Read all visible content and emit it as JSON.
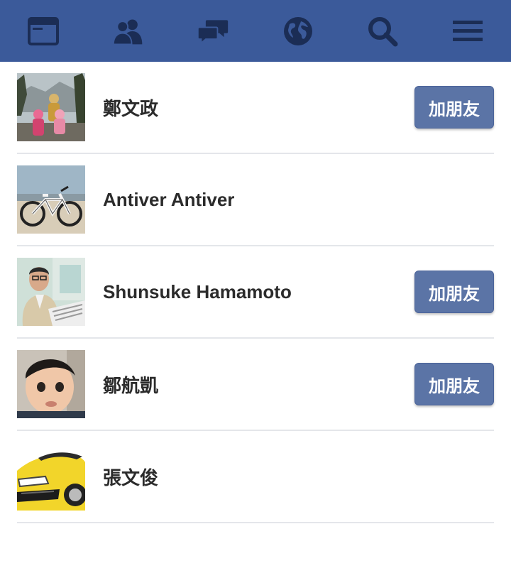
{
  "theme": {
    "bar_color": "#3b5a9a",
    "icon_color": "#1b2d55",
    "button_color": "#5b74a6"
  },
  "nav": {
    "icons": [
      "news-feed-icon",
      "friend-requests-icon",
      "messages-icon",
      "notifications-globe-icon",
      "search-icon",
      "menu-icon"
    ]
  },
  "people": [
    {
      "name": "鄭文政",
      "avatar": "family-in-park-photo",
      "button": "加朋友"
    },
    {
      "name": "Antiver Antiver",
      "avatar": "bicycle-on-beach-photo",
      "button": ""
    },
    {
      "name": "Shunsuke Hamamoto",
      "avatar": "man-reading-newspaper-photo",
      "button": "加朋友"
    },
    {
      "name": "鄒航凱",
      "avatar": "toddler-face-photo",
      "button": "加朋友"
    },
    {
      "name": "張文俊",
      "avatar": "yellow-sports-car-photo",
      "button": ""
    }
  ]
}
